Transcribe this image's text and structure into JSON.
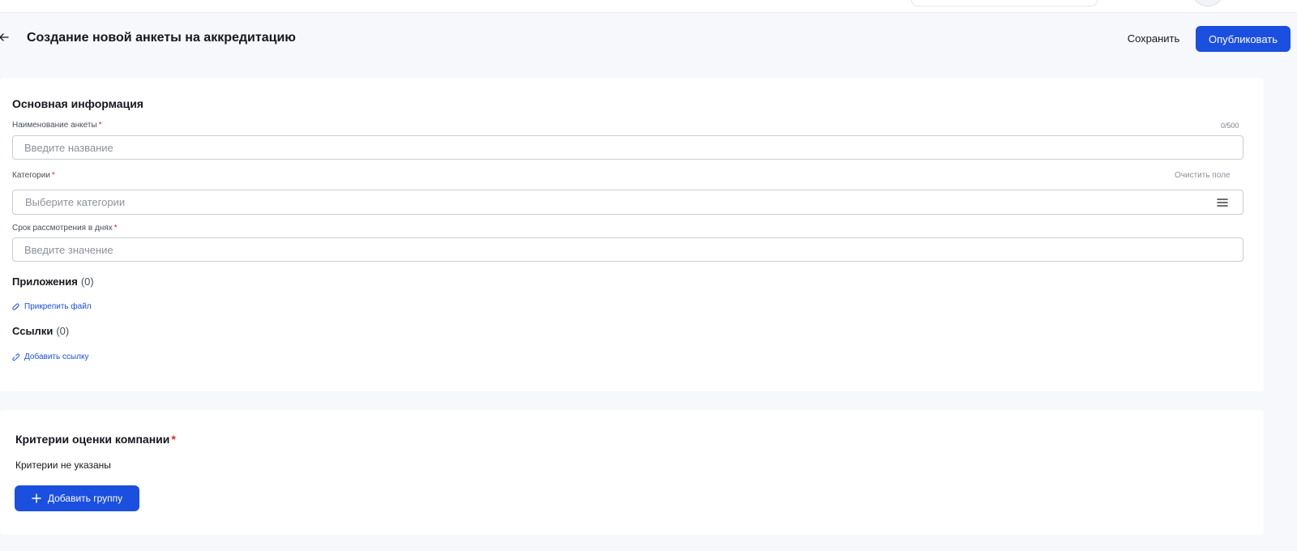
{
  "header": {
    "title": "Создание новой анкеты на аккредитацию",
    "save_label": "Сохранить",
    "publish_label": "Опубликовать",
    "accent_color": "#1b4fe0",
    "back_icon": "arrow-left-icon"
  },
  "main_info": {
    "title": "Основная информация",
    "name_field": {
      "label": "Наименование анкеты",
      "counter": "0/500",
      "placeholder": "Введите название",
      "value": ""
    },
    "categories_field": {
      "label": "Категории",
      "clear_label": "Очистить поле",
      "placeholder": "Выберите категории",
      "icon": "menu-icon"
    },
    "term_field": {
      "label": "Срок рассмотрения в днях",
      "placeholder": "Введите значение",
      "value": ""
    },
    "attachments": {
      "title": "Приложения",
      "count": "(0)",
      "action_label": "Прикрепить файл",
      "icon": "paperclip-icon"
    },
    "links": {
      "title": "Ссылки",
      "count": "(0)",
      "action_label": "Добавить ссылку",
      "icon": "link-icon"
    }
  },
  "criteria": {
    "title": "Критерии оценки компании",
    "empty_text": "Критерии не указаны",
    "add_group_label": "Добавить группу",
    "add_icon": "plus-icon"
  },
  "required_marker": "*",
  "required_color": "#e3262f"
}
